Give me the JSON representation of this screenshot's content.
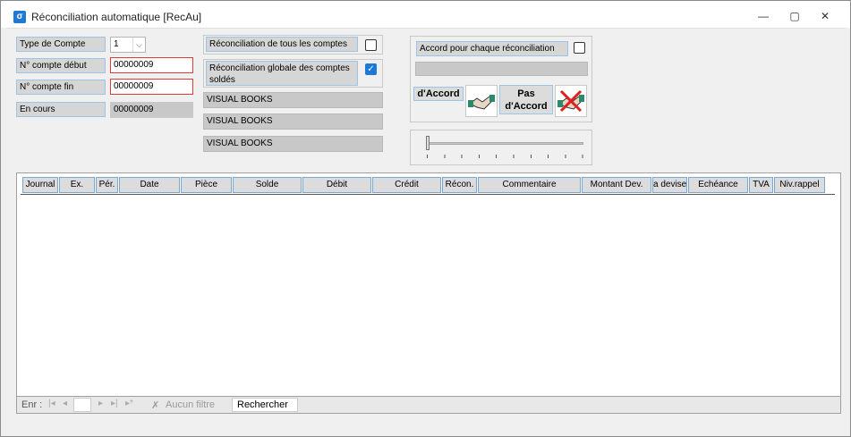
{
  "window": {
    "title": "Réconciliation automatique [RecAu]"
  },
  "form": {
    "type_compte_label": "Type de Compte",
    "type_compte_value": "1",
    "compte_debut_label": "N° compte début",
    "compte_debut_value": "00000009",
    "compte_fin_label": "N° compte fin",
    "compte_fin_value": "00000009",
    "en_cours_label": "En cours",
    "en_cours_value": "00000009"
  },
  "options": {
    "tous_comptes_label": "Réconciliation de tous les comptes",
    "globale_label": "Réconciliation globale des comptes soldés",
    "visual_books": [
      "VISUAL BOOKS",
      "VISUAL BOOKS",
      "VISUAL BOOKS"
    ]
  },
  "accord": {
    "chaque_label": "Accord pour chaque réconciliation",
    "accord_label": "d'Accord",
    "pas_accord_label": "Pas d'Accord"
  },
  "grid": {
    "columns": [
      "Journal",
      "Ex.",
      "Pér.",
      "Date",
      "Pièce",
      "Solde",
      "Débit",
      "Crédit",
      "Récon.",
      "Commentaire",
      "Montant Dev.",
      "a devise",
      "Echéance",
      "TVA",
      "Niv.rappel"
    ]
  },
  "navigation": {
    "record_label": "Enr :",
    "filter_label": "Aucun filtre",
    "search_label": "Rechercher"
  }
}
